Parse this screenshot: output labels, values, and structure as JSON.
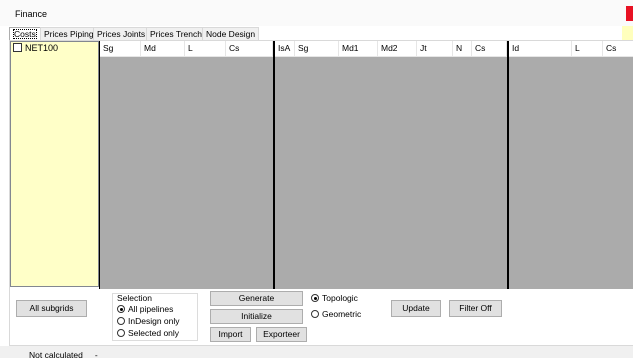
{
  "window": {
    "title": "Finance"
  },
  "tabs": [
    {
      "label": "Costs",
      "active": true
    },
    {
      "label": "Prices Piping",
      "active": false
    },
    {
      "label": "Prices Joints",
      "active": false
    },
    {
      "label": "Prices Trench",
      "active": false
    },
    {
      "label": "Node Design",
      "active": false
    }
  ],
  "tree": {
    "items": [
      {
        "label": "NET100",
        "checked": false
      }
    ]
  },
  "grids": [
    {
      "columns": [
        "Sg",
        "Md",
        "L",
        "Cs"
      ]
    },
    {
      "columns": [
        "IsA",
        "Sg",
        "Md1",
        "Md2",
        "Jt",
        "N",
        "Cs"
      ]
    },
    {
      "columns": [
        "Id",
        "L",
        "Cs"
      ]
    }
  ],
  "buttons": {
    "all_subgrids": "All subgrids",
    "generate": "Generate",
    "initialize": "Initialize",
    "import": "Import",
    "export": "Exporteer",
    "update": "Update",
    "filter": "Filter Off"
  },
  "selection": {
    "legend": "Selection",
    "options": [
      {
        "label": "All pipelines",
        "selected": true
      },
      {
        "label": "InDesign only",
        "selected": false
      },
      {
        "label": "Selected only",
        "selected": false
      }
    ]
  },
  "mode": {
    "options": [
      {
        "label": "Topologic",
        "selected": true
      },
      {
        "label": "Geometric",
        "selected": false
      }
    ]
  },
  "status": {
    "text": "Not calculated",
    "extra": "-"
  },
  "colors": {
    "tree_bg": "#ffffc8",
    "grid_bg": "#ababab",
    "side_strip": "#ffffbd",
    "close": "#e81123"
  }
}
